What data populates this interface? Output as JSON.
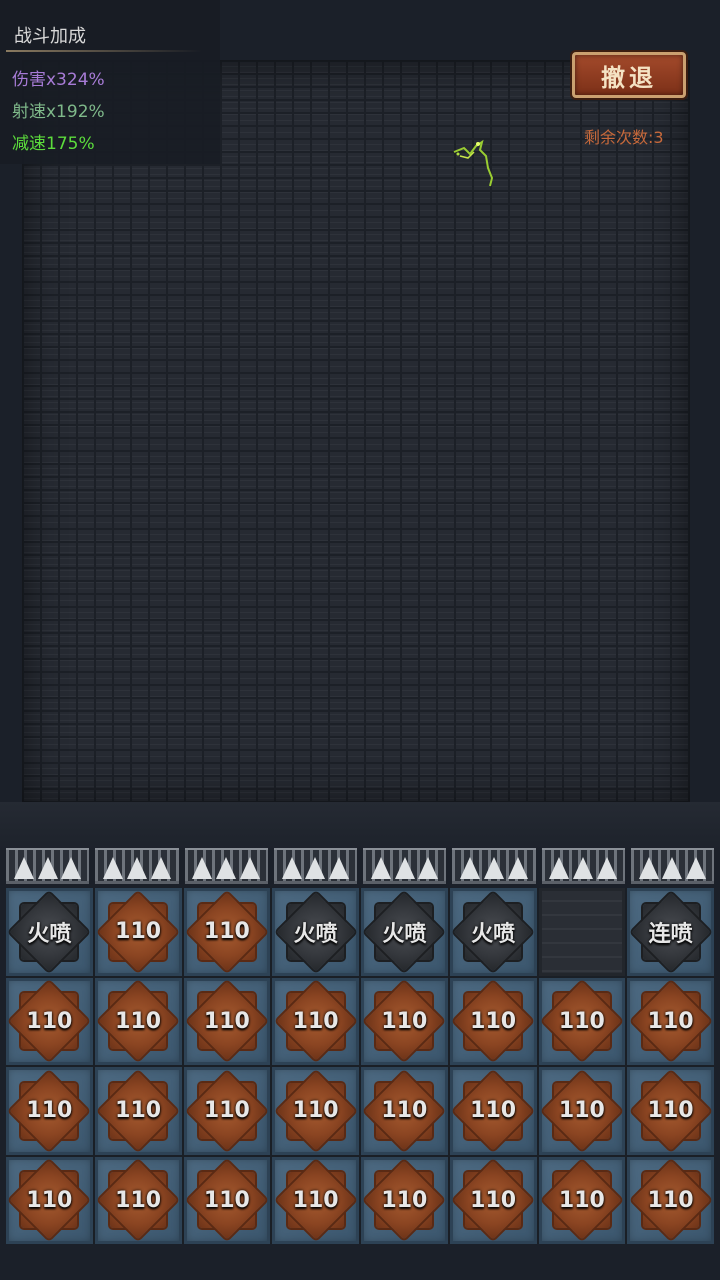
{
  "stats": {
    "title": "战斗加成",
    "damage": "伤害x324%",
    "fire_rate": "射速x192%",
    "slow": "减速175%"
  },
  "retreat": {
    "label": "撤退"
  },
  "remaining": "剩余次数:3",
  "colors": {
    "damage": "#a77bd6",
    "fire_rate": "#7fb98a",
    "slow": "#5cdc3c",
    "retreat_button": "#8e3a20",
    "remaining": "#c7693b"
  },
  "grid": {
    "rows": [
      [
        {
          "label": "火喷",
          "kind": "iron"
        },
        {
          "label": "110",
          "kind": "copper"
        },
        {
          "label": "110",
          "kind": "copper"
        },
        {
          "label": "火喷",
          "kind": "iron"
        },
        {
          "label": "火喷",
          "kind": "iron"
        },
        {
          "label": "火喷",
          "kind": "iron"
        },
        {
          "label": "",
          "kind": "empty"
        },
        {
          "label": "连喷",
          "kind": "iron"
        }
      ],
      [
        {
          "label": "110",
          "kind": "copper"
        },
        {
          "label": "110",
          "kind": "copper"
        },
        {
          "label": "110",
          "kind": "copper"
        },
        {
          "label": "110",
          "kind": "copper"
        },
        {
          "label": "110",
          "kind": "copper"
        },
        {
          "label": "110",
          "kind": "copper"
        },
        {
          "label": "110",
          "kind": "copper"
        },
        {
          "label": "110",
          "kind": "copper"
        }
      ],
      [
        {
          "label": "110",
          "kind": "copper"
        },
        {
          "label": "110",
          "kind": "copper"
        },
        {
          "label": "110",
          "kind": "copper"
        },
        {
          "label": "110",
          "kind": "copper"
        },
        {
          "label": "110",
          "kind": "copper"
        },
        {
          "label": "110",
          "kind": "copper"
        },
        {
          "label": "110",
          "kind": "copper"
        },
        {
          "label": "110",
          "kind": "copper"
        }
      ],
      [
        {
          "label": "110",
          "kind": "copper"
        },
        {
          "label": "110",
          "kind": "copper"
        },
        {
          "label": "110",
          "kind": "copper"
        },
        {
          "label": "110",
          "kind": "copper"
        },
        {
          "label": "110",
          "kind": "copper"
        },
        {
          "label": "110",
          "kind": "copper"
        },
        {
          "label": "110",
          "kind": "copper"
        },
        {
          "label": "110",
          "kind": "copper"
        }
      ]
    ]
  }
}
